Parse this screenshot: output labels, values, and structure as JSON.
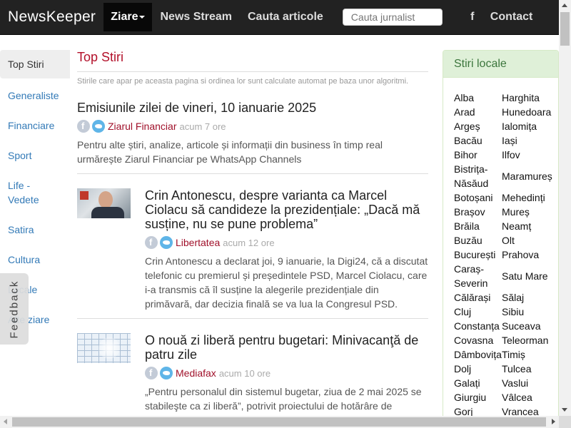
{
  "navbar": {
    "brand": "NewsKeeper",
    "active_menu": "Ziare",
    "links": [
      "News Stream",
      "Cauta articole"
    ],
    "search_placeholder": "Cauta jurnalist",
    "facebook_icon": "f",
    "contact": "Contact"
  },
  "sidebar": {
    "items": [
      {
        "label": "Top Stiri",
        "active": true
      },
      {
        "label": "Generaliste"
      },
      {
        "label": "Financiare"
      },
      {
        "label": "Sport"
      },
      {
        "label": "Life -\nVedete"
      },
      {
        "label": "Satira"
      },
      {
        "label": "Cultura"
      },
      {
        "label": "Locale"
      },
      {
        "label": "Alte ziare"
      }
    ]
  },
  "feedback": "Feedback",
  "main": {
    "title": "Top Stiri",
    "info": "Stirile care apar pe aceasta pagina si ordinea lor sunt calculate automat pe baza unor algoritmi.",
    "articles": [
      {
        "title": "Emisiunile zilei de vineri, 10 ianuarie 2025",
        "source": "Ziarul Financiar",
        "ago": "acum 7 ore",
        "excerpt": "Pentru alte știri, analize, articole și informații din business în timp real urmărește Ziarul Financiar pe WhatsApp Channels"
      },
      {
        "title": "Crin Antonescu, despre varianta ca Marcel Ciolacu să candideze la prezidențiale: „Dacă mă susține, nu se pune problema”",
        "source": "Libertatea",
        "ago": "acum 12 ore",
        "excerpt": "Crin Antonescu a declarat joi, 9 ianuarie, la Digi24, că a discutat telefonic cu premierul și președintele PSD, Marcel Ciolacu, care i-a transmis că îl susține la alegerile prezidențiale din primăvară, dar decizia finală se va lua la Congresul PSD."
      },
      {
        "title": "O nouă zi liberă pentru bugetari: Minivacanţă de patru zile",
        "source": "Mediafax",
        "ago": "acum 10 ore",
        "excerpt": "„Pentru personalul din sistemul bugetar, ziua de 2 mai 2025 se stabileşte ca zi liberă”, potrivit proiectului de hotărâre de"
      }
    ]
  },
  "panel": {
    "title": "Stiri locale",
    "rows": [
      [
        "Alba",
        "Harghita"
      ],
      [
        "Arad",
        "Hunedoara"
      ],
      [
        "Argeș",
        "Ialomița"
      ],
      [
        "Bacău",
        "Iași"
      ],
      [
        "Bihor",
        "Ilfov"
      ],
      [
        "Bistrița-Năsăud",
        "Maramureș"
      ],
      [
        "Botoșani",
        "Mehedinți"
      ],
      [
        "Brașov",
        "Mureș"
      ],
      [
        "Brăila",
        "Neamț"
      ],
      [
        "Buzău",
        "Olt"
      ],
      [
        "București",
        "Prahova"
      ],
      [
        "Caraș-Severin",
        "Satu Mare"
      ],
      [
        "Călărași",
        "Sălaj"
      ],
      [
        "Cluj",
        "Sibiu"
      ],
      [
        "Constanța",
        "Suceava"
      ],
      [
        "Covasna",
        "Teleorman"
      ],
      [
        "Dâmbovița",
        "Timiș"
      ],
      [
        "Dolj",
        "Tulcea"
      ],
      [
        "Galați",
        "Vaslui"
      ],
      [
        "Giurgiu",
        "Vâlcea"
      ],
      [
        "Gorj",
        "Vrancea"
      ]
    ]
  },
  "colors": {
    "navbar_bg": "#222222",
    "accent_red": "#b3102a",
    "link_blue": "#337ab7",
    "panel_green_bg": "#dff0d8",
    "panel_green_text": "#3c763d"
  }
}
